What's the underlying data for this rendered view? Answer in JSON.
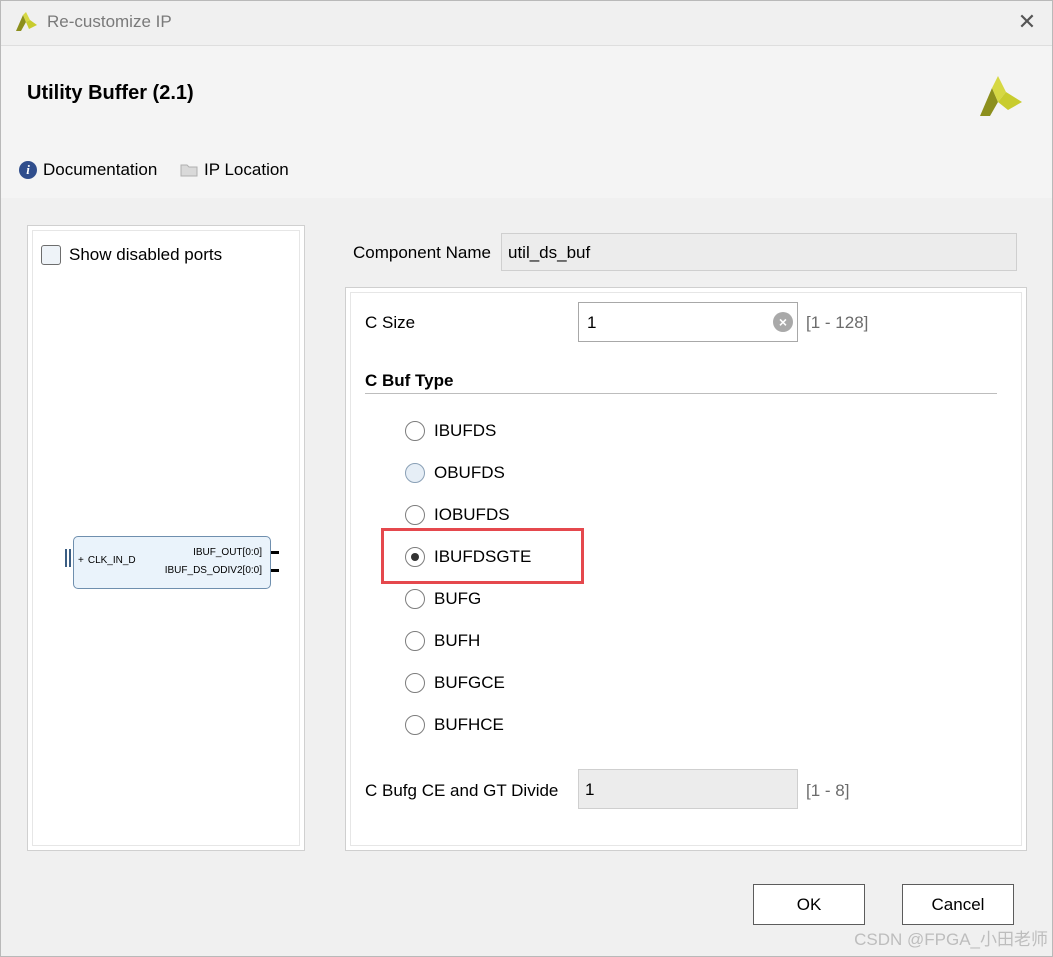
{
  "window": {
    "title": "Re-customize IP",
    "close_glyph": "✕"
  },
  "header": {
    "ip_title": "Utility Buffer (2.1)",
    "documentation": "Documentation",
    "ip_location": "IP Location",
    "info_glyph": "i"
  },
  "left_panel": {
    "show_disabled_ports": "Show disabled ports",
    "block": {
      "input_port": "CLK_IN_D",
      "plus": "+",
      "output_ports": [
        "IBUF_OUT[0:0]",
        "IBUF_DS_ODIV2[0:0]"
      ]
    }
  },
  "form": {
    "component_name_label": "Component Name",
    "component_name_value": "util_ds_buf",
    "c_size_label": "C Size",
    "c_size_value": "1",
    "c_size_range": "[1 - 128]",
    "buf_type_title": "C Buf Type",
    "buf_types": [
      {
        "label": "IBUFDS",
        "checked": false
      },
      {
        "label": "OBUFDS",
        "checked": false
      },
      {
        "label": "IOBUFDS",
        "checked": false
      },
      {
        "label": "IBUFDSGTE",
        "checked": true
      },
      {
        "label": "BUFG",
        "checked": false
      },
      {
        "label": "BUFH",
        "checked": false
      },
      {
        "label": "BUFGCE",
        "checked": false
      },
      {
        "label": "BUFHCE",
        "checked": false
      }
    ],
    "divide_label": "C Bufg CE and GT Divide",
    "divide_value": "1",
    "divide_range": "[1 - 8]"
  },
  "buttons": {
    "ok": "OK",
    "cancel": "Cancel"
  },
  "watermark": "CSDN @FPGA_小田老师",
  "colors": {
    "highlight": "#e5484d",
    "logo_yellow": "#c8cc2e",
    "logo_dark": "#8c8f1d",
    "info_icon": "#2f4d8c"
  }
}
